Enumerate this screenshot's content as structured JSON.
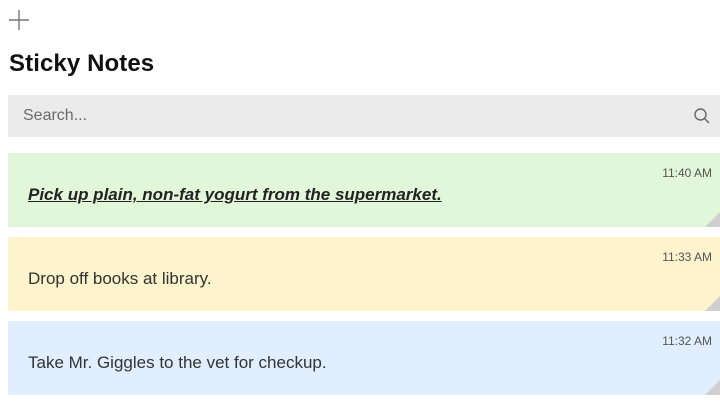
{
  "app": {
    "title": "Sticky Notes"
  },
  "toolbar": {
    "add_icon": "plus-icon"
  },
  "search": {
    "placeholder": "Search...",
    "value": "",
    "icon": "search-icon"
  },
  "notes": [
    {
      "time": "11:40 AM",
      "text": "Pick up plain, non-fat yogurt from the supermarket.",
      "color": "#e2f6d9",
      "bold": true,
      "italic": true,
      "underline": true
    },
    {
      "time": "11:33 AM",
      "text": "Drop off books at library.",
      "color": "#fdf3cc"
    },
    {
      "time": "11:32 AM",
      "text": "Take Mr. Giggles to the vet for checkup.",
      "color": "#e0eefd"
    }
  ]
}
